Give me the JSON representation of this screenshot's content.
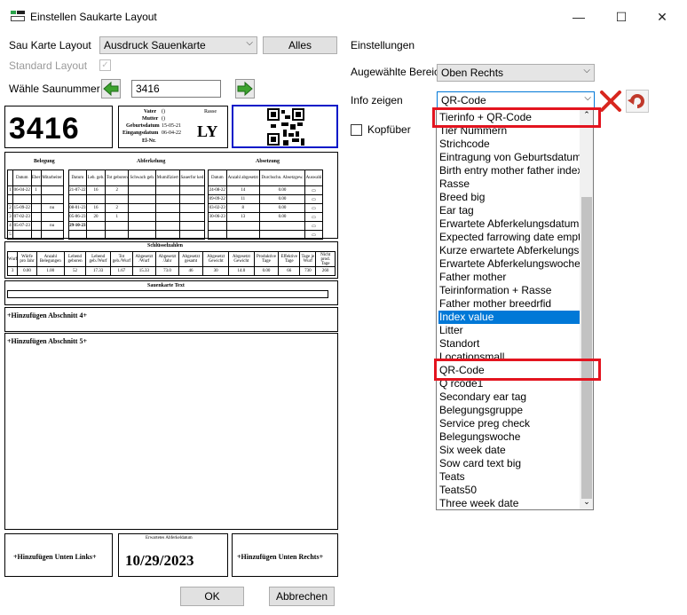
{
  "window": {
    "title": "Einstellen Saukarte Layout",
    "minimize": "—",
    "maximize": "☐",
    "close": "✕"
  },
  "left": {
    "layout_label": "Sau Karte Layout",
    "layout_value": "Ausdruck Sauenkarte",
    "alles_button": "Alles",
    "standard_layout_label": "Standard Layout",
    "standard_layout_checked": true,
    "sow_number_label": "Wähle Saunummer",
    "sow_number_value": "3416"
  },
  "preview": {
    "sow_number": "3416",
    "header_info": {
      "vater_label": "Vater",
      "vater_value": "()",
      "mutter_label": "Mutter",
      "mutter_value": "()",
      "rasse_label": "Rasse",
      "geburtsdatum_label": "Geburtsdatum",
      "geburtsdatum_value": "15-05-21",
      "eingangsdatum_label": "Eingangsdatum",
      "eingangsdatum_value": "06-04-22",
      "id_label": "El-Nr.",
      "code": "LY"
    },
    "section_headers": [
      "Belegung",
      "Abferkelung",
      "Absetzung"
    ],
    "col_headers": [
      "Datum",
      "Eber",
      "Mitarbeiter",
      "Datum",
      "Leb. geb.",
      "Tot geboren",
      "Schwach geb.",
      "Mumifiziert",
      "Sauerfor ked",
      "Datum",
      "Anzahl abgesetzt",
      "Durchschn. Absetzgew.",
      "Auswahl"
    ],
    "rows": [
      [
        "1",
        "06-04-22",
        "1",
        "",
        "21-07-22",
        "16",
        "2",
        "",
        "",
        "",
        "24-08-22",
        "14",
        "0.00",
        "▭"
      ],
      [
        "",
        "",
        "",
        "",
        "",
        "",
        "",
        "",
        "",
        "",
        "09-09-22",
        "11",
        "0.00",
        "▭"
      ],
      [
        "2",
        "15-09-22",
        "",
        "nu",
        "08-01-23",
        "16",
        "2",
        "",
        "",
        "",
        "03-02-23",
        "8",
        "0.00",
        "▭"
      ],
      [
        "3",
        "07-02-23",
        "",
        "",
        "05-06-23",
        "20",
        "1",
        "",
        "",
        "",
        "30-06-23",
        "13",
        "0.00",
        "▭"
      ],
      [
        "4",
        "05-07-23",
        "",
        "nu",
        "29-10-23",
        "",
        "",
        "",
        "",
        "",
        "",
        "",
        "",
        "▭"
      ],
      [
        "5",
        "",
        "",
        "",
        "",
        "",
        "",
        "",
        "",
        "",
        "",
        "",
        "",
        "▭"
      ]
    ],
    "key_figures_title": "Schlüsselzahlen",
    "key_figures_headers": [
      "Wurf",
      "Würfe pro Jahr",
      "Anzahl Belegungen",
      "Lebend geboren",
      "Lebend geb./Wurf",
      "Tot geb./Wurf",
      "Abgesetzt /Wurf",
      "Abgesetzt /Jahr",
      "Abgesetzt gesamt",
      "Abgesetzt Gewicht",
      "Abgesetzt Gewicht",
      "Produktive Tage",
      "Effektive Tage",
      "Tage je Wurf",
      "Nicht prod. Tage"
    ],
    "key_figures_values": [
      "3",
      "0.00",
      "1.00",
      "52",
      "17.33",
      "1.67",
      "15.33",
      "73.0",
      "46",
      "30",
      "14.0",
      "0.00",
      "66",
      "730",
      "260"
    ],
    "text_title": "Sauenkarte Text",
    "add_section_4": "+Hinzufügen Abschnitt 4+",
    "add_section_5": "+Hinzufügen Abschnitt 5+",
    "add_bottom_left": "+Hinzufügen Unten Links+",
    "expected_farrowing_label": "Erwartetes Abferkeldatum",
    "expected_farrowing_date": "10/29/2023",
    "add_bottom_right": "+Hinzufügen Unten Rechts+"
  },
  "right": {
    "settings_title": "Einstellungen",
    "area_label": "Augewählte Bereiche",
    "area_value": "Oben Rechts",
    "info_label": "Info zeigen",
    "info_value": "QR-Code",
    "header_checkbox_label": "Kopfüber",
    "header_checkbox_checked": false
  },
  "listbox": {
    "items": [
      "Tierinfo + QR-Code",
      "Tier Nummern",
      "Strichcode",
      "Eintragung von Geburtsdatum",
      "Birth entry mother father index",
      "Rasse",
      "Breed big",
      "Ear tag",
      "Erwartete Abferkelungsdatum",
      "Expected  farrowing  date empt",
      "Kurze  erwartete Abferkelungsd",
      "Erwartete Abferkelungswoche",
      "Father mother",
      "Teirinformation + Rasse",
      "Father mother breedrfid",
      "Index value",
      "Litter",
      "Standort",
      "Locationsmall",
      "QR-Code",
      "Q rcode1",
      "Secondary ear tag",
      "Belegungsgruppe",
      "Service preg check",
      "Belegungswoche",
      "Six week date",
      "Sow card text big",
      "Teats",
      "Teats50",
      "Three week date"
    ],
    "selected_index": 15
  },
  "footer": {
    "ok": "OK",
    "cancel": "Abbrechen"
  },
  "colors": {
    "highlight": "#0078d7",
    "annotation": "#e3141f",
    "preview_blue_box": "#0018c8"
  }
}
